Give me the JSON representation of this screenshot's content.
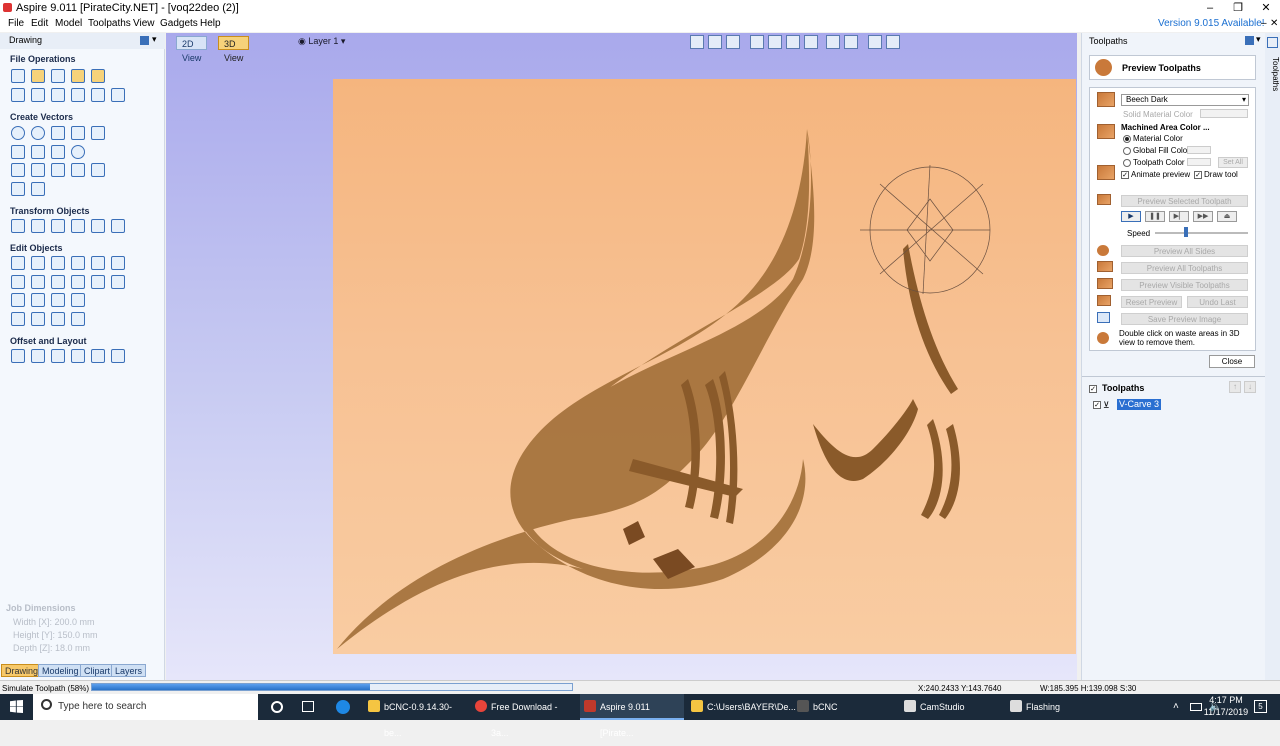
{
  "window": {
    "title": "Aspire 9.011 [PirateCity.NET] - [voq22deo (2)]",
    "controls": [
      "–",
      "❐",
      "✕"
    ]
  },
  "menu": {
    "items": [
      "File",
      "Edit",
      "Model",
      "Toolpaths",
      "View",
      "Gadgets",
      "Help"
    ],
    "version_note": "Version 9.015 Available!"
  },
  "left_panel": {
    "header": "Drawing",
    "sections": {
      "file_operations": "File Operations",
      "create_vectors": "Create Vectors",
      "transform_objects": "Transform Objects",
      "edit_objects": "Edit Objects",
      "offset_layout": "Offset and Layout"
    },
    "job_dimensions": {
      "title": "Job Dimensions",
      "width": "Width  [X]: 200.0 mm",
      "height": "Height [Y]: 150.0 mm",
      "depth": "Depth  [Z]: 18.0 mm"
    },
    "tabs": [
      "Drawing",
      "Modeling",
      "Clipart",
      "Layers"
    ]
  },
  "view": {
    "tabs": [
      "2D View",
      "3D View"
    ],
    "layer": "Layer 1"
  },
  "right_panel": {
    "header": "Toolpaths",
    "preview_title": "Preview Toolpaths",
    "material": "Beech Dark",
    "solid_material_color": "Solid Material Color",
    "machined_area_color": "Machined Area Color ...",
    "options": {
      "material_color": "Material Color",
      "global_fill_color": "Global Fill Color",
      "toolpath_color": "Toolpath Color",
      "set_all": "Set All",
      "animate_preview": "Animate preview",
      "draw_tool": "Draw tool"
    },
    "buttons": {
      "preview_selected": "Preview Selected Toolpath",
      "speed": "Speed",
      "preview_all_sides": "Preview All Sides",
      "preview_all": "Preview All Toolpaths",
      "preview_visible": "Preview Visible Toolpaths",
      "reset_preview": "Reset Preview",
      "undo_last": "Undo Last",
      "save_preview": "Save Preview Image",
      "close": "Close"
    },
    "hint": "Double click on waste areas in 3D view to remove them.",
    "toolpaths_list_title": "Toolpaths",
    "toolpaths": [
      "V-Carve 3"
    ],
    "side_tab": "Toolpaths"
  },
  "status": {
    "left": "Simulate Toolpath (58%)",
    "progress": 0.58,
    "coords": "X:240.2433 Y:143.7640",
    "size": "W:185.395  H:139.098  S:30"
  },
  "taskbar": {
    "search_placeholder": "Type here to search",
    "apps": [
      "bCNC-0.9.14.30-be...",
      "Free Download - 3a...",
      "Aspire 9.011 [Pirate...",
      "C:\\Users\\BAYER\\De...",
      "bCNC",
      "CamStudio",
      "Flashing"
    ],
    "time": "4:17 PM",
    "date": "11/17/2019",
    "notifications": "5"
  },
  "colors": {
    "wood": "#f7c193",
    "carve": "#8a5a2a",
    "viewport_bg": "#b8bbef",
    "accent_tab": "#f6d27a"
  }
}
